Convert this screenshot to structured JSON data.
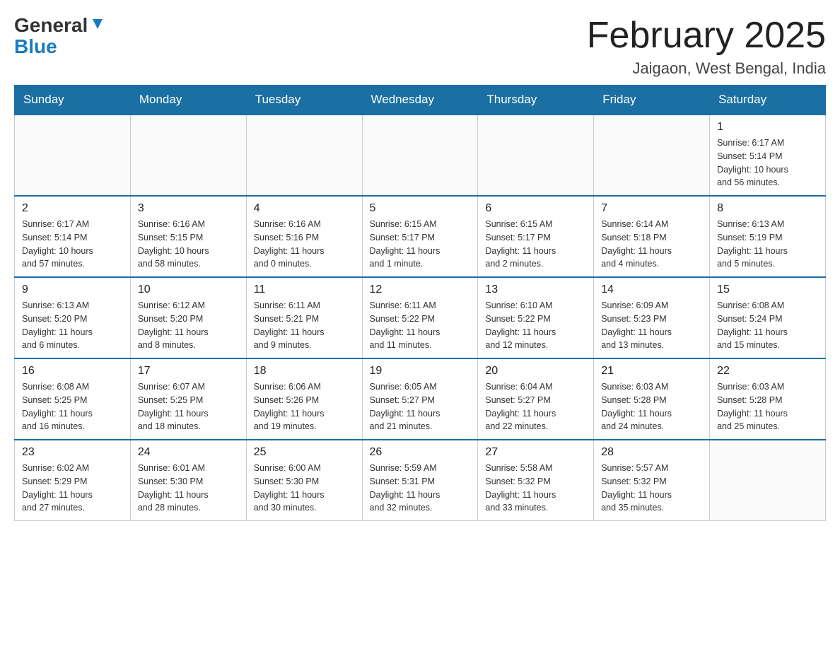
{
  "header": {
    "title": "February 2025",
    "subtitle": "Jaigaon, West Bengal, India",
    "logo_general": "General",
    "logo_blue": "Blue"
  },
  "weekdays": [
    "Sunday",
    "Monday",
    "Tuesday",
    "Wednesday",
    "Thursday",
    "Friday",
    "Saturday"
  ],
  "weeks": [
    [
      {
        "day": "",
        "info": ""
      },
      {
        "day": "",
        "info": ""
      },
      {
        "day": "",
        "info": ""
      },
      {
        "day": "",
        "info": ""
      },
      {
        "day": "",
        "info": ""
      },
      {
        "day": "",
        "info": ""
      },
      {
        "day": "1",
        "info": "Sunrise: 6:17 AM\nSunset: 5:14 PM\nDaylight: 10 hours\nand 56 minutes."
      }
    ],
    [
      {
        "day": "2",
        "info": "Sunrise: 6:17 AM\nSunset: 5:14 PM\nDaylight: 10 hours\nand 57 minutes."
      },
      {
        "day": "3",
        "info": "Sunrise: 6:16 AM\nSunset: 5:15 PM\nDaylight: 10 hours\nand 58 minutes."
      },
      {
        "day": "4",
        "info": "Sunrise: 6:16 AM\nSunset: 5:16 PM\nDaylight: 11 hours\nand 0 minutes."
      },
      {
        "day": "5",
        "info": "Sunrise: 6:15 AM\nSunset: 5:17 PM\nDaylight: 11 hours\nand 1 minute."
      },
      {
        "day": "6",
        "info": "Sunrise: 6:15 AM\nSunset: 5:17 PM\nDaylight: 11 hours\nand 2 minutes."
      },
      {
        "day": "7",
        "info": "Sunrise: 6:14 AM\nSunset: 5:18 PM\nDaylight: 11 hours\nand 4 minutes."
      },
      {
        "day": "8",
        "info": "Sunrise: 6:13 AM\nSunset: 5:19 PM\nDaylight: 11 hours\nand 5 minutes."
      }
    ],
    [
      {
        "day": "9",
        "info": "Sunrise: 6:13 AM\nSunset: 5:20 PM\nDaylight: 11 hours\nand 6 minutes."
      },
      {
        "day": "10",
        "info": "Sunrise: 6:12 AM\nSunset: 5:20 PM\nDaylight: 11 hours\nand 8 minutes."
      },
      {
        "day": "11",
        "info": "Sunrise: 6:11 AM\nSunset: 5:21 PM\nDaylight: 11 hours\nand 9 minutes."
      },
      {
        "day": "12",
        "info": "Sunrise: 6:11 AM\nSunset: 5:22 PM\nDaylight: 11 hours\nand 11 minutes."
      },
      {
        "day": "13",
        "info": "Sunrise: 6:10 AM\nSunset: 5:22 PM\nDaylight: 11 hours\nand 12 minutes."
      },
      {
        "day": "14",
        "info": "Sunrise: 6:09 AM\nSunset: 5:23 PM\nDaylight: 11 hours\nand 13 minutes."
      },
      {
        "day": "15",
        "info": "Sunrise: 6:08 AM\nSunset: 5:24 PM\nDaylight: 11 hours\nand 15 minutes."
      }
    ],
    [
      {
        "day": "16",
        "info": "Sunrise: 6:08 AM\nSunset: 5:25 PM\nDaylight: 11 hours\nand 16 minutes."
      },
      {
        "day": "17",
        "info": "Sunrise: 6:07 AM\nSunset: 5:25 PM\nDaylight: 11 hours\nand 18 minutes."
      },
      {
        "day": "18",
        "info": "Sunrise: 6:06 AM\nSunset: 5:26 PM\nDaylight: 11 hours\nand 19 minutes."
      },
      {
        "day": "19",
        "info": "Sunrise: 6:05 AM\nSunset: 5:27 PM\nDaylight: 11 hours\nand 21 minutes."
      },
      {
        "day": "20",
        "info": "Sunrise: 6:04 AM\nSunset: 5:27 PM\nDaylight: 11 hours\nand 22 minutes."
      },
      {
        "day": "21",
        "info": "Sunrise: 6:03 AM\nSunset: 5:28 PM\nDaylight: 11 hours\nand 24 minutes."
      },
      {
        "day": "22",
        "info": "Sunrise: 6:03 AM\nSunset: 5:28 PM\nDaylight: 11 hours\nand 25 minutes."
      }
    ],
    [
      {
        "day": "23",
        "info": "Sunrise: 6:02 AM\nSunset: 5:29 PM\nDaylight: 11 hours\nand 27 minutes."
      },
      {
        "day": "24",
        "info": "Sunrise: 6:01 AM\nSunset: 5:30 PM\nDaylight: 11 hours\nand 28 minutes."
      },
      {
        "day": "25",
        "info": "Sunrise: 6:00 AM\nSunset: 5:30 PM\nDaylight: 11 hours\nand 30 minutes."
      },
      {
        "day": "26",
        "info": "Sunrise: 5:59 AM\nSunset: 5:31 PM\nDaylight: 11 hours\nand 32 minutes."
      },
      {
        "day": "27",
        "info": "Sunrise: 5:58 AM\nSunset: 5:32 PM\nDaylight: 11 hours\nand 33 minutes."
      },
      {
        "day": "28",
        "info": "Sunrise: 5:57 AM\nSunset: 5:32 PM\nDaylight: 11 hours\nand 35 minutes."
      },
      {
        "day": "",
        "info": ""
      }
    ]
  ]
}
